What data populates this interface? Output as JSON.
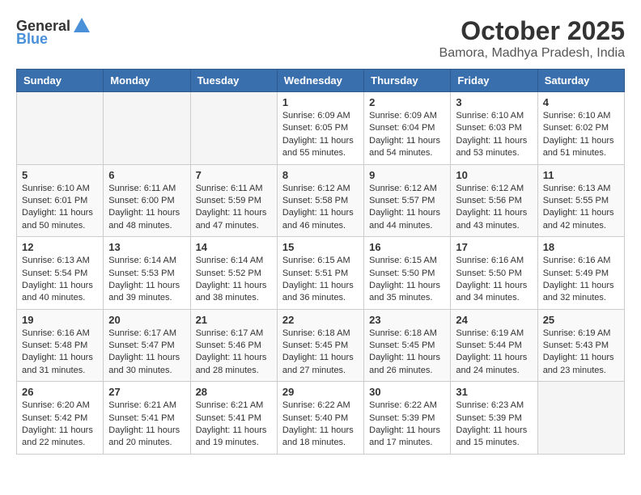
{
  "logo": {
    "text_general": "General",
    "text_blue": "Blue"
  },
  "title": "October 2025",
  "location": "Bamora, Madhya Pradesh, India",
  "weekdays": [
    "Sunday",
    "Monday",
    "Tuesday",
    "Wednesday",
    "Thursday",
    "Friday",
    "Saturday"
  ],
  "weeks": [
    [
      {
        "day": "",
        "info": ""
      },
      {
        "day": "",
        "info": ""
      },
      {
        "day": "",
        "info": ""
      },
      {
        "day": "1",
        "info": "Sunrise: 6:09 AM\nSunset: 6:05 PM\nDaylight: 11 hours and 55 minutes."
      },
      {
        "day": "2",
        "info": "Sunrise: 6:09 AM\nSunset: 6:04 PM\nDaylight: 11 hours and 54 minutes."
      },
      {
        "day": "3",
        "info": "Sunrise: 6:10 AM\nSunset: 6:03 PM\nDaylight: 11 hours and 53 minutes."
      },
      {
        "day": "4",
        "info": "Sunrise: 6:10 AM\nSunset: 6:02 PM\nDaylight: 11 hours and 51 minutes."
      }
    ],
    [
      {
        "day": "5",
        "info": "Sunrise: 6:10 AM\nSunset: 6:01 PM\nDaylight: 11 hours and 50 minutes."
      },
      {
        "day": "6",
        "info": "Sunrise: 6:11 AM\nSunset: 6:00 PM\nDaylight: 11 hours and 48 minutes."
      },
      {
        "day": "7",
        "info": "Sunrise: 6:11 AM\nSunset: 5:59 PM\nDaylight: 11 hours and 47 minutes."
      },
      {
        "day": "8",
        "info": "Sunrise: 6:12 AM\nSunset: 5:58 PM\nDaylight: 11 hours and 46 minutes."
      },
      {
        "day": "9",
        "info": "Sunrise: 6:12 AM\nSunset: 5:57 PM\nDaylight: 11 hours and 44 minutes."
      },
      {
        "day": "10",
        "info": "Sunrise: 6:12 AM\nSunset: 5:56 PM\nDaylight: 11 hours and 43 minutes."
      },
      {
        "day": "11",
        "info": "Sunrise: 6:13 AM\nSunset: 5:55 PM\nDaylight: 11 hours and 42 minutes."
      }
    ],
    [
      {
        "day": "12",
        "info": "Sunrise: 6:13 AM\nSunset: 5:54 PM\nDaylight: 11 hours and 40 minutes."
      },
      {
        "day": "13",
        "info": "Sunrise: 6:14 AM\nSunset: 5:53 PM\nDaylight: 11 hours and 39 minutes."
      },
      {
        "day": "14",
        "info": "Sunrise: 6:14 AM\nSunset: 5:52 PM\nDaylight: 11 hours and 38 minutes."
      },
      {
        "day": "15",
        "info": "Sunrise: 6:15 AM\nSunset: 5:51 PM\nDaylight: 11 hours and 36 minutes."
      },
      {
        "day": "16",
        "info": "Sunrise: 6:15 AM\nSunset: 5:50 PM\nDaylight: 11 hours and 35 minutes."
      },
      {
        "day": "17",
        "info": "Sunrise: 6:16 AM\nSunset: 5:50 PM\nDaylight: 11 hours and 34 minutes."
      },
      {
        "day": "18",
        "info": "Sunrise: 6:16 AM\nSunset: 5:49 PM\nDaylight: 11 hours and 32 minutes."
      }
    ],
    [
      {
        "day": "19",
        "info": "Sunrise: 6:16 AM\nSunset: 5:48 PM\nDaylight: 11 hours and 31 minutes."
      },
      {
        "day": "20",
        "info": "Sunrise: 6:17 AM\nSunset: 5:47 PM\nDaylight: 11 hours and 30 minutes."
      },
      {
        "day": "21",
        "info": "Sunrise: 6:17 AM\nSunset: 5:46 PM\nDaylight: 11 hours and 28 minutes."
      },
      {
        "day": "22",
        "info": "Sunrise: 6:18 AM\nSunset: 5:45 PM\nDaylight: 11 hours and 27 minutes."
      },
      {
        "day": "23",
        "info": "Sunrise: 6:18 AM\nSunset: 5:45 PM\nDaylight: 11 hours and 26 minutes."
      },
      {
        "day": "24",
        "info": "Sunrise: 6:19 AM\nSunset: 5:44 PM\nDaylight: 11 hours and 24 minutes."
      },
      {
        "day": "25",
        "info": "Sunrise: 6:19 AM\nSunset: 5:43 PM\nDaylight: 11 hours and 23 minutes."
      }
    ],
    [
      {
        "day": "26",
        "info": "Sunrise: 6:20 AM\nSunset: 5:42 PM\nDaylight: 11 hours and 22 minutes."
      },
      {
        "day": "27",
        "info": "Sunrise: 6:21 AM\nSunset: 5:41 PM\nDaylight: 11 hours and 20 minutes."
      },
      {
        "day": "28",
        "info": "Sunrise: 6:21 AM\nSunset: 5:41 PM\nDaylight: 11 hours and 19 minutes."
      },
      {
        "day": "29",
        "info": "Sunrise: 6:22 AM\nSunset: 5:40 PM\nDaylight: 11 hours and 18 minutes."
      },
      {
        "day": "30",
        "info": "Sunrise: 6:22 AM\nSunset: 5:39 PM\nDaylight: 11 hours and 17 minutes."
      },
      {
        "day": "31",
        "info": "Sunrise: 6:23 AM\nSunset: 5:39 PM\nDaylight: 11 hours and 15 minutes."
      },
      {
        "day": "",
        "info": ""
      }
    ]
  ]
}
